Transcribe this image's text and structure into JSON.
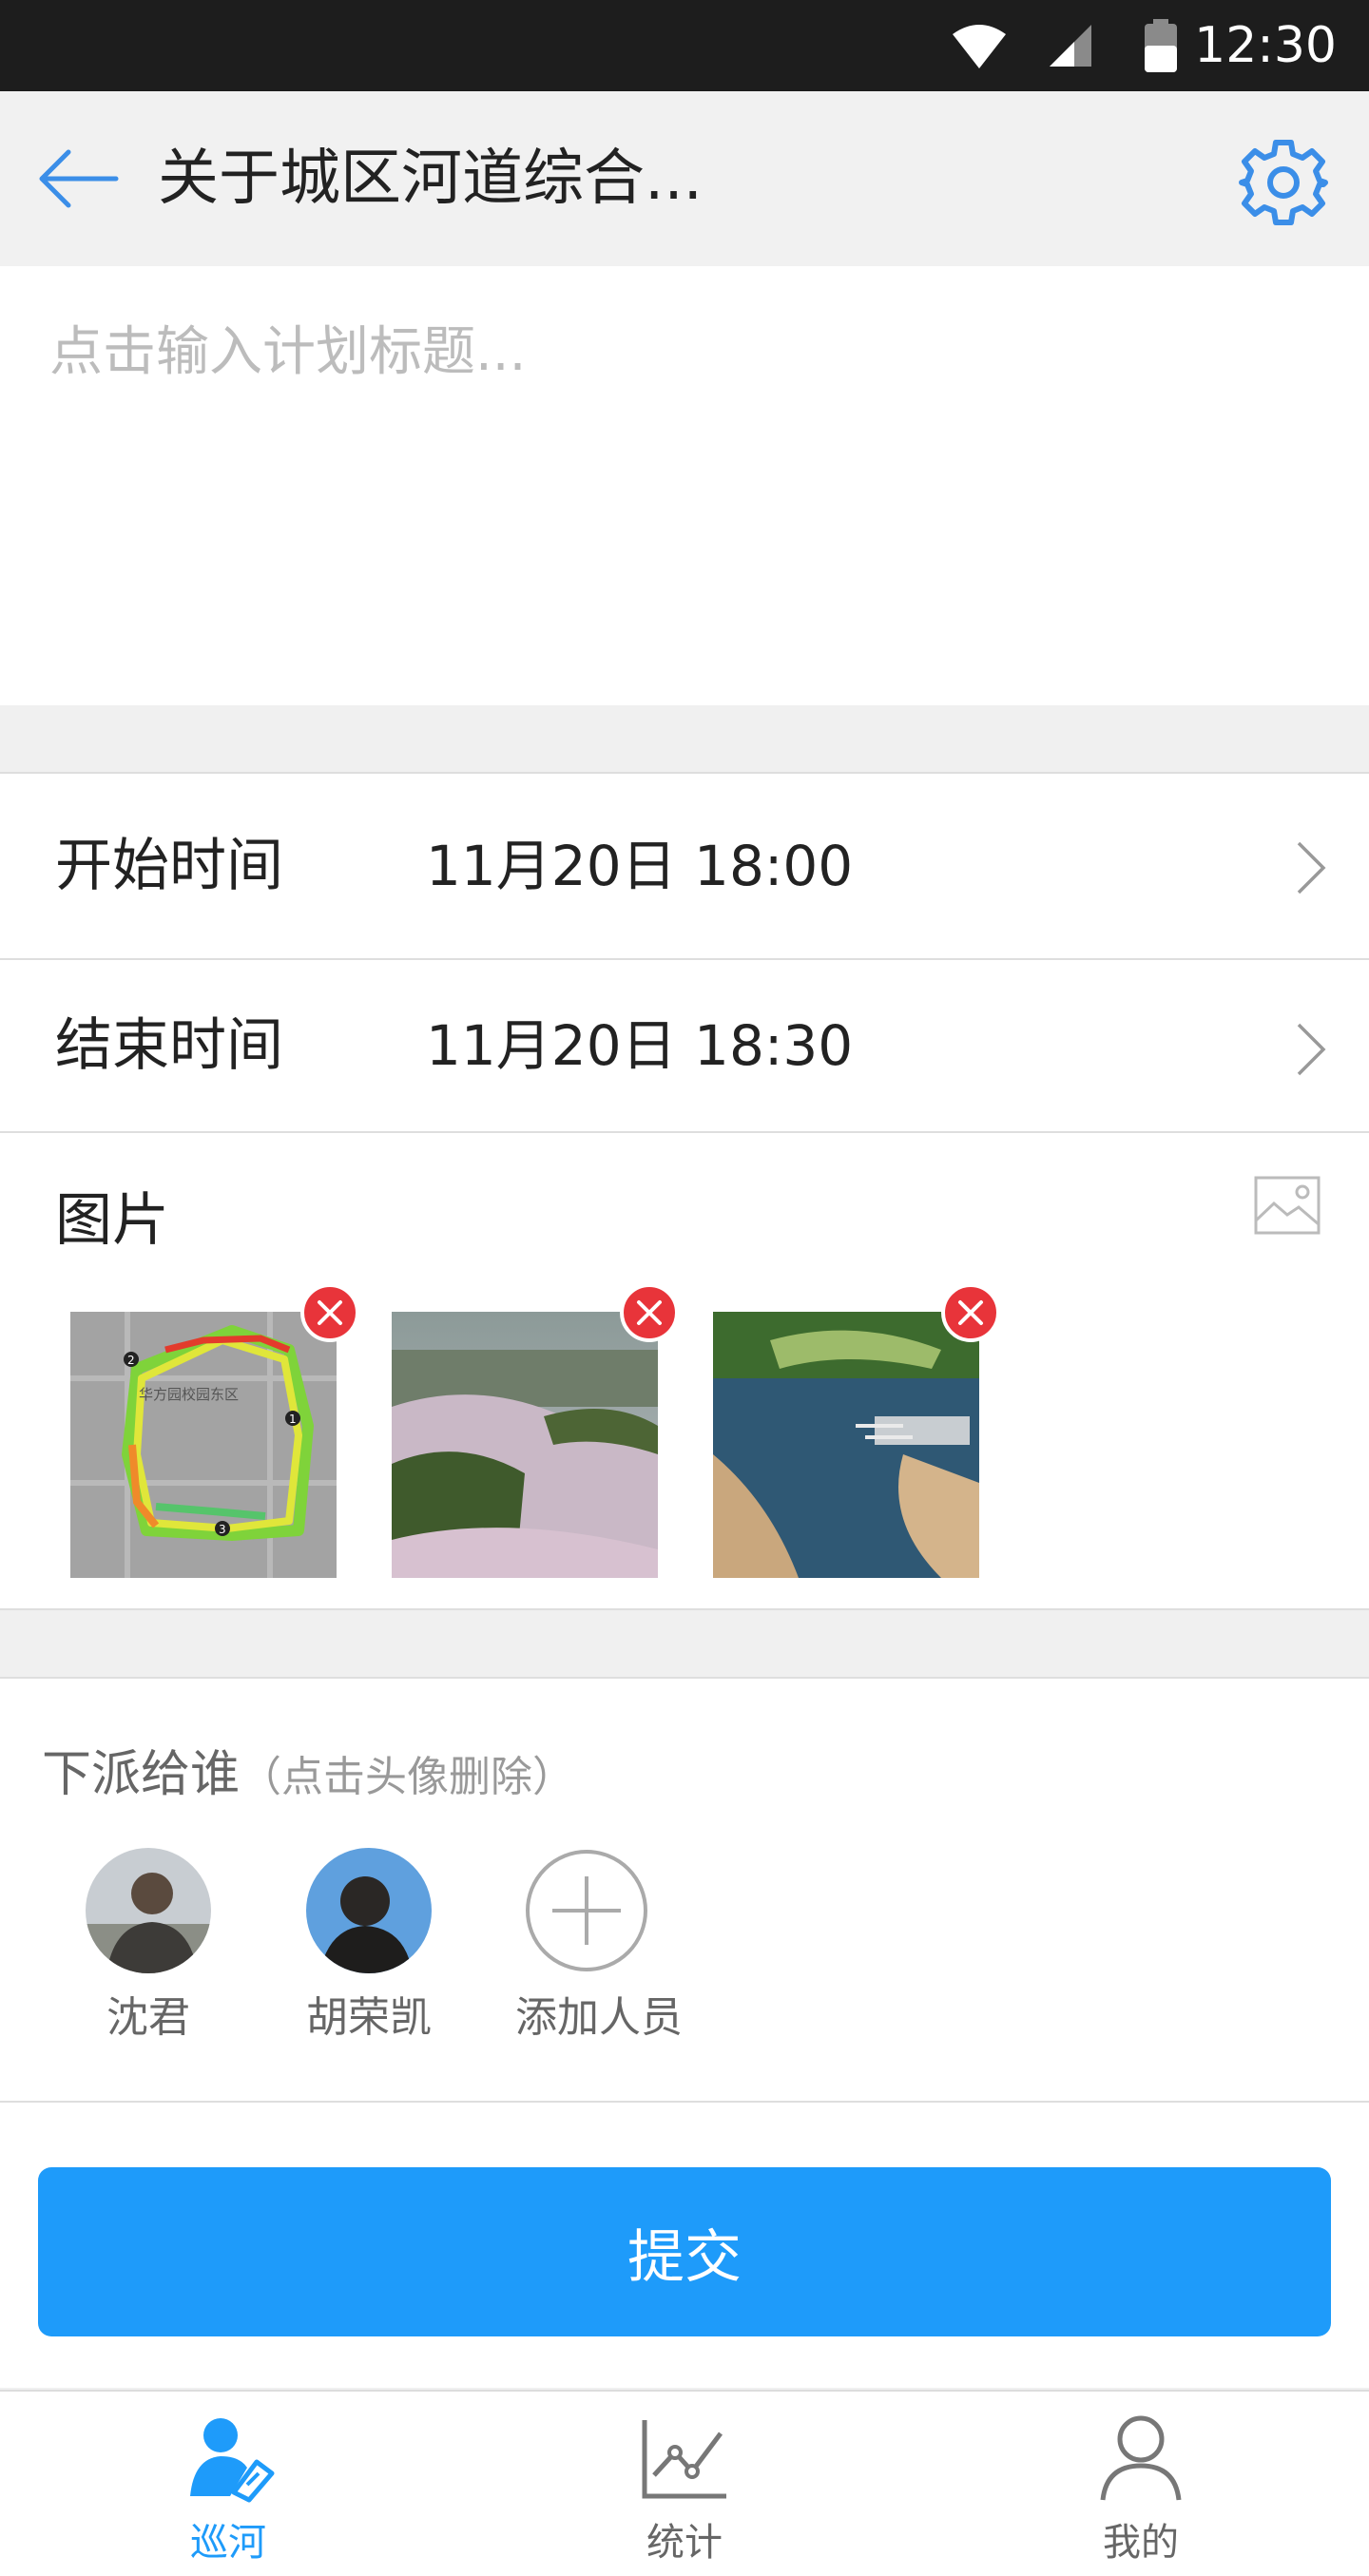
{
  "status_bar": {
    "time": "12:30"
  },
  "header": {
    "title": "关于城区河道综合..."
  },
  "plan_title": {
    "placeholder": "点击输入计划标题..."
  },
  "time_rows": [
    {
      "label": "开始时间",
      "value": "11月20日 18:00"
    },
    {
      "label": "结束时间",
      "value": "11月20日 18:30"
    }
  ],
  "photos": {
    "label": "图片",
    "items": [
      {
        "kind": "map-trace",
        "map_text": "华方园校园东区",
        "markers": [
          "1",
          "2",
          "3"
        ]
      },
      {
        "kind": "river-wetland"
      },
      {
        "kind": "river-aerial"
      }
    ]
  },
  "assign": {
    "label": "下派给谁",
    "hint": "（点击头像删除）",
    "people": [
      {
        "name": "沈君"
      },
      {
        "name": "胡荣凯"
      }
    ],
    "add_label": "添加人员"
  },
  "submit_label": "提交",
  "tabs": [
    {
      "label": "巡河",
      "icon": "patrol-icon",
      "active": true
    },
    {
      "label": "统计",
      "icon": "stats-icon",
      "active": false
    },
    {
      "label": "我的",
      "icon": "profile-icon",
      "active": false
    }
  ],
  "colors": {
    "accent": "#1e9bfa",
    "delete": "#e8343a",
    "active_tab": "#1e9bfa",
    "inactive_tab": "#666666"
  }
}
